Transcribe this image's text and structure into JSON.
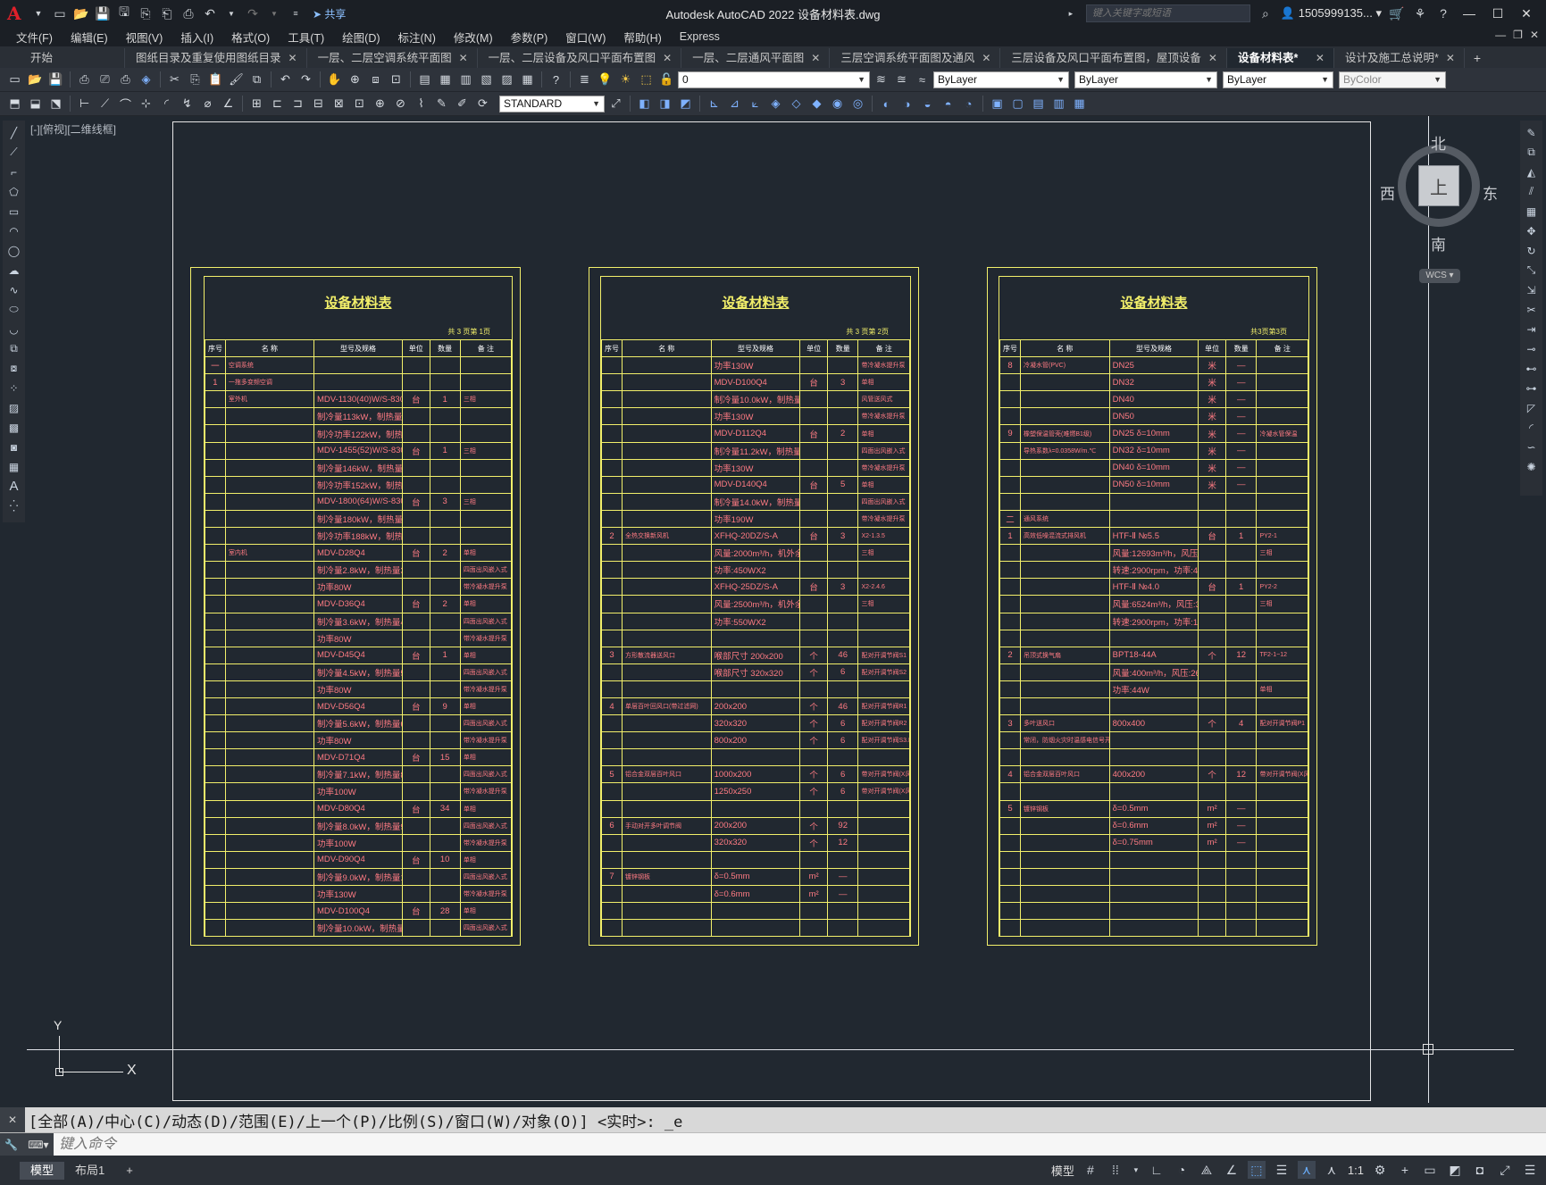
{
  "app": {
    "title": "Autodesk AutoCAD 2022    设备材料表.dwg",
    "logo": "A",
    "share_label": "共享",
    "search_placeholder": "键入关键字或短语",
    "user": "1505999135...",
    "help": "?"
  },
  "menu": [
    "文件(F)",
    "编辑(E)",
    "视图(V)",
    "插入(I)",
    "格式(O)",
    "工具(T)",
    "绘图(D)",
    "标注(N)",
    "修改(M)",
    "参数(P)",
    "窗口(W)",
    "帮助(H)",
    "Express"
  ],
  "tabs": [
    {
      "label": "开始",
      "closable": false
    },
    {
      "label": "图纸目录及重复使用图纸目录",
      "closable": true
    },
    {
      "label": "一层、二层空调系统平面图",
      "closable": true
    },
    {
      "label": "一层、二层设备及风口平面布置图",
      "closable": true
    },
    {
      "label": "一层、二层通风平面图",
      "closable": true
    },
    {
      "label": "三层空调系统平面图及通风",
      "closable": true
    },
    {
      "label": "三层设备及风口平面布置图，屋顶设备",
      "closable": true
    },
    {
      "label": "设备材料表*",
      "closable": true,
      "active": true
    },
    {
      "label": "设计及施工总说明*",
      "closable": true
    }
  ],
  "toolbar": {
    "layer_value": "0",
    "color_value": "ByLayer",
    "linetype_value": "ByLayer",
    "lineweight_value": "ByLayer",
    "plotstyle_value": "ByColor",
    "textstyle_value": "STANDARD"
  },
  "viewport_label": "[-][俯视][二维线框]",
  "viewcube": {
    "north": "北",
    "south": "南",
    "east": "东",
    "west": "西",
    "top": "上",
    "wcs": "WCS"
  },
  "ucs": {
    "x": "X",
    "y": "Y"
  },
  "sheets": [
    {
      "title": "设备材料表",
      "page": "共 3 页第 1页",
      "headers": [
        "序号",
        "名 称",
        "型号及规格",
        "单位",
        "数量",
        "备 注"
      ],
      "rows": [
        [
          "一",
          "空调系统",
          "",
          "",
          "",
          ""
        ],
        [
          "1",
          "一拖多变频空调",
          "",
          "",
          "",
          ""
        ],
        [
          "",
          "室外机",
          "MDV-1130(40)W/S-830",
          "台",
          "1",
          "三相"
        ],
        [
          "",
          "",
          "制冷量113kW，制热量37.7kW",
          "",
          "",
          ""
        ],
        [
          "",
          "",
          "制冷功率122kW，制热功率35.8kW",
          "",
          "",
          ""
        ],
        [
          "",
          "",
          "MDV-1455(52)W/S-830",
          "台",
          "1",
          "三相"
        ],
        [
          "",
          "",
          "制冷量146kW，制热量48.6kW",
          "",
          "",
          ""
        ],
        [
          "",
          "",
          "制冷功率152kW，制热功率44.6kW",
          "",
          "",
          ""
        ],
        [
          "",
          "",
          "MDV-1800(64)W/S-830",
          "台",
          "3",
          "三相"
        ],
        [
          "",
          "",
          "制冷量180kW，制热量60.0kW",
          "",
          "",
          ""
        ],
        [
          "",
          "",
          "制冷功率188kW，制热功率56.0kW",
          "",
          "",
          ""
        ],
        [
          "",
          "室内机",
          "MDV-D28Q4",
          "台",
          "2",
          "单相"
        ],
        [
          "",
          "",
          "制冷量2.8kW，制热量3.2kW",
          "",
          "",
          "四面出风嵌入式"
        ],
        [
          "",
          "",
          "功率80W",
          "",
          "",
          "带冷凝水提升泵"
        ],
        [
          "",
          "",
          "MDV-D36Q4",
          "台",
          "2",
          "单相"
        ],
        [
          "",
          "",
          "制冷量3.6kW，制热量4.0kW",
          "",
          "",
          "四面出风嵌入式"
        ],
        [
          "",
          "",
          "功率80W",
          "",
          "",
          "带冷凝水提升泵"
        ],
        [
          "",
          "",
          "MDV-D45Q4",
          "台",
          "1",
          "单相"
        ],
        [
          "",
          "",
          "制冷量4.5kW，制热量5.0kW",
          "",
          "",
          "四面出风嵌入式"
        ],
        [
          "",
          "",
          "功率80W",
          "",
          "",
          "带冷凝水提升泵"
        ],
        [
          "",
          "",
          "MDV-D56Q4",
          "台",
          "9",
          "单相"
        ],
        [
          "",
          "",
          "制冷量5.6kW，制热量6.3kW",
          "",
          "",
          "四面出风嵌入式"
        ],
        [
          "",
          "",
          "功率80W",
          "",
          "",
          "带冷凝水提升泵"
        ],
        [
          "",
          "",
          "MDV-D71Q4",
          "台",
          "15",
          "单相"
        ],
        [
          "",
          "",
          "制冷量7.1kW，制热量8.0kW",
          "",
          "",
          "四面出风嵌入式"
        ],
        [
          "",
          "",
          "功率100W",
          "",
          "",
          "带冷凝水提升泵"
        ],
        [
          "",
          "",
          "MDV-D80Q4",
          "台",
          "34",
          "单相"
        ],
        [
          "",
          "",
          "制冷量8.0kW，制热量9.0kW",
          "",
          "",
          "四面出风嵌入式"
        ],
        [
          "",
          "",
          "功率100W",
          "",
          "",
          "带冷凝水提升泵"
        ],
        [
          "",
          "",
          "MDV-D90Q4",
          "台",
          "10",
          "单相"
        ],
        [
          "",
          "",
          "制冷量9.0kW，制热量10.0kW",
          "",
          "",
          "四面出风嵌入式"
        ],
        [
          "",
          "",
          "功率130W",
          "",
          "",
          "带冷凝水提升泵"
        ],
        [
          "",
          "",
          "MDV-D100Q4",
          "台",
          "28",
          "单相"
        ],
        [
          "",
          "",
          "制冷量10.0kW，制热量11.0kW",
          "",
          "",
          "四面出风嵌入式"
        ]
      ]
    },
    {
      "title": "设备材料表",
      "page": "共 3 页第 2页",
      "headers": [
        "序号",
        "名 称",
        "型号及规格",
        "单位",
        "数量",
        "备 注"
      ],
      "rows": [
        [
          "",
          "",
          "功率130W",
          "",
          "",
          "带冷凝水提升泵"
        ],
        [
          "",
          "",
          "MDV-D100Q4",
          "台",
          "3",
          "单相"
        ],
        [
          "",
          "",
          "制冷量10.0kW，制热量11.0kW",
          "",
          "",
          "风管送风式"
        ],
        [
          "",
          "",
          "功率130W",
          "",
          "",
          "带冷凝水提升泵"
        ],
        [
          "",
          "",
          "MDV-D112Q4",
          "台",
          "2",
          "单相"
        ],
        [
          "",
          "",
          "制冷量11.2kW，制热量12.5kW",
          "",
          "",
          "四面出风嵌入式"
        ],
        [
          "",
          "",
          "功率130W",
          "",
          "",
          "带冷凝水提升泵"
        ],
        [
          "",
          "",
          "MDV-D140Q4",
          "台",
          "5",
          "单相"
        ],
        [
          "",
          "",
          "制冷量14.0kW，制热量15.0kW",
          "",
          "",
          "四面出风嵌入式"
        ],
        [
          "",
          "",
          "功率190W",
          "",
          "",
          "带冷凝水提升泵"
        ],
        [
          "2",
          "全热交换新风机",
          "XFHQ-20DZ/S-A",
          "台",
          "3",
          "X2-1.3.5"
        ],
        [
          "",
          "",
          "风量:2000m³/h，机外余压:190Pa",
          "",
          "",
          "三相"
        ],
        [
          "",
          "",
          "功率:450WX2",
          "",
          "",
          ""
        ],
        [
          "",
          "",
          "XFHQ-25DZ/S-A",
          "台",
          "3",
          "X2-2.4.6"
        ],
        [
          "",
          "",
          "风量:2500m³/h，机外余压:150Pa",
          "",
          "",
          "三相"
        ],
        [
          "",
          "",
          "功率:550WX2",
          "",
          "",
          ""
        ],
        [
          "",
          "",
          "",
          "",
          "",
          ""
        ],
        [
          "3",
          "方形散流器送风口",
          "喉部尺寸 200x200",
          "个",
          "46",
          "配对开调节阀S1"
        ],
        [
          "",
          "",
          "喉部尺寸 320x320",
          "个",
          "6",
          "配对开调节阀S2"
        ],
        [
          "",
          "",
          "",
          "",
          "",
          ""
        ],
        [
          "4",
          "单层百叶回风口(带过滤网)",
          "200x200",
          "个",
          "46",
          "配对开调节阀R1"
        ],
        [
          "",
          "",
          "320x320",
          "个",
          "6",
          "配对开调节阀R2"
        ],
        [
          "",
          "",
          "800x200",
          "个",
          "6",
          "配对开调节阀S3.R3"
        ],
        [
          "",
          "",
          "",
          "",
          "",
          ""
        ],
        [
          "5",
          "铝合金双层百叶风口",
          "1000x200",
          "个",
          "6",
          "带对开调节阀(X风)"
        ],
        [
          "",
          "",
          "1250x250",
          "个",
          "6",
          "带对开调节阀(X风)"
        ],
        [
          "",
          "",
          "",
          "",
          "",
          ""
        ],
        [
          "6",
          "手动对开多叶调节阀",
          "200x200",
          "个",
          "92",
          ""
        ],
        [
          "",
          "",
          "320x320",
          "个",
          "12",
          ""
        ],
        [
          "",
          "",
          "",
          "",
          "",
          ""
        ],
        [
          "7",
          "镀锌钢板",
          "δ=0.5mm",
          "m²",
          "—",
          ""
        ],
        [
          "",
          "",
          "δ=0.6mm",
          "m²",
          "—",
          ""
        ],
        [
          "",
          "",
          "",
          "",
          "",
          ""
        ],
        [
          "",
          "",
          "",
          "",
          "",
          ""
        ]
      ]
    },
    {
      "title": "设备材料表",
      "page": "共3页第3页",
      "headers": [
        "序号",
        "名 称",
        "型号及规格",
        "单位",
        "数量",
        "备 注"
      ],
      "rows": [
        [
          "8",
          "冷凝水管(PVC)",
          "DN25",
          "米",
          "—",
          ""
        ],
        [
          "",
          "",
          "DN32",
          "米",
          "—",
          ""
        ],
        [
          "",
          "",
          "DN40",
          "米",
          "—",
          ""
        ],
        [
          "",
          "",
          "DN50",
          "米",
          "—",
          ""
        ],
        [
          "9",
          "橡塑保温管壳(难燃B1级)",
          "DN25  δ=10mm",
          "米",
          "—",
          "冷凝水管保温"
        ],
        [
          "",
          "导热系数λ=0.0358W/m.℃",
          "DN32  δ=10mm",
          "米",
          "—",
          ""
        ],
        [
          "",
          "",
          "DN40  δ=10mm",
          "米",
          "—",
          ""
        ],
        [
          "",
          "",
          "DN50  δ=10mm",
          "米",
          "—",
          ""
        ],
        [
          "",
          "",
          "",
          "",
          "",
          ""
        ],
        [
          "二",
          "通风系统",
          "",
          "",
          "",
          ""
        ],
        [
          "1",
          "高效低噪混流式排风机",
          "HTF-Ⅱ №5.5",
          "台",
          "1",
          "PY2-1"
        ],
        [
          "",
          "",
          "风量:12693m³/h，风压:536Pa",
          "",
          "",
          "三相"
        ],
        [
          "",
          "",
          "转速:2900rpm，功率:4KW",
          "",
          "",
          ""
        ],
        [
          "",
          "",
          "HTF-Ⅱ №4.0",
          "台",
          "1",
          "PY2-2"
        ],
        [
          "",
          "",
          "风量:6524m³/h，风压:383Pa",
          "",
          "",
          "三相"
        ],
        [
          "",
          "",
          "转速:2900rpm，功率:1.5KW",
          "",
          "",
          ""
        ],
        [
          "",
          "",
          "",
          "",
          "",
          ""
        ],
        [
          "2",
          "吊顶式换气扇",
          "BPT18-44A",
          "个",
          "12",
          "TF2-1~12"
        ],
        [
          "",
          "",
          "风量:400m³/h，风压:265Pa",
          "",
          "",
          ""
        ],
        [
          "",
          "",
          "功率:44W",
          "",
          "",
          "单相"
        ],
        [
          "",
          "",
          "",
          "",
          "",
          ""
        ],
        [
          "3",
          "多叶送风口",
          "800x400",
          "个",
          "4",
          "配对开调节阀P1"
        ],
        [
          "",
          "常闭，防烟火灾时温感电信号开启，280℃关闭",
          "",
          "",
          "",
          ""
        ],
        [
          "",
          "",
          "",
          "",
          "",
          ""
        ],
        [
          "4",
          "铝合金双层百叶风口",
          "400x200",
          "个",
          "12",
          "带对开调节阀(X风)"
        ],
        [
          "",
          "",
          "",
          "",
          "",
          ""
        ],
        [
          "5",
          "镀锌钢板",
          "δ=0.5mm",
          "m²",
          "—",
          ""
        ],
        [
          "",
          "",
          "δ=0.6mm",
          "m²",
          "—",
          ""
        ],
        [
          "",
          "",
          "δ=0.75mm",
          "m²",
          "—",
          ""
        ],
        [
          "",
          "",
          "",
          "",
          "",
          ""
        ],
        [
          "",
          "",
          "",
          "",
          "",
          ""
        ],
        [
          "",
          "",
          "",
          "",
          "",
          ""
        ],
        [
          "",
          "",
          "",
          "",
          "",
          ""
        ],
        [
          "",
          "",
          "",
          "",
          "",
          ""
        ]
      ]
    }
  ],
  "command": {
    "history": "[全部(A)/中心(C)/动态(D)/范围(E)/上一个(P)/比例(S)/窗口(W)/对象(O)] <实时>: _e",
    "placeholder": "键入命令"
  },
  "layout_tabs": [
    {
      "label": "模型",
      "active": true
    },
    {
      "label": "布局1",
      "active": false
    }
  ],
  "status": {
    "model": "模型",
    "scale": "1:1"
  },
  "colors": {
    "sheet_border": "#f2ef6a",
    "table_text": "#ff7b83",
    "background": "#212830"
  }
}
